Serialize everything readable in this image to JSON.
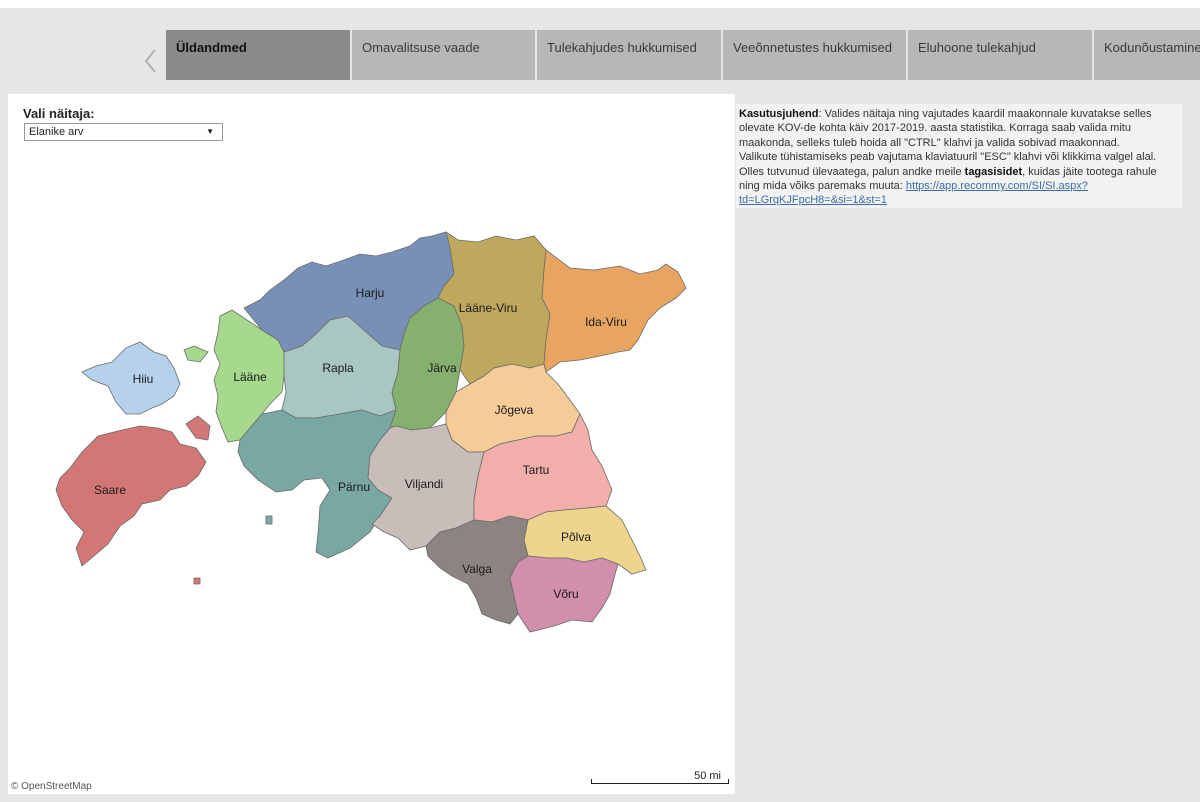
{
  "tabs": [
    {
      "label": "Üldandmed",
      "active": true
    },
    {
      "label": "Omavalitsuse vaade",
      "active": false
    },
    {
      "label": "Tulekahjudes hukkumised",
      "active": false
    },
    {
      "label": "Veeõnnetustes hukkumised",
      "active": false
    },
    {
      "label": "Eluhoone tulekahjud",
      "active": false
    },
    {
      "label": "Kodunõustamine",
      "active": false
    }
  ],
  "tab_prev_icon": "chevron-left-icon",
  "control": {
    "label": "Vali näitaja:",
    "selected": "Elanike arv",
    "icon": "caret-down-icon"
  },
  "map": {
    "counties": [
      {
        "name": "Harju",
        "color": "#7890b6"
      },
      {
        "name": "Lääne-Viru",
        "color": "#bea85e"
      },
      {
        "name": "Ida-Viru",
        "color": "#e8a562"
      },
      {
        "name": "Lääne",
        "color": "#a6d88d"
      },
      {
        "name": "Rapla",
        "color": "#a8c7c3"
      },
      {
        "name": "Järva",
        "color": "#86b06e"
      },
      {
        "name": "Hiiu",
        "color": "#b6d1ec"
      },
      {
        "name": "Jõgeva",
        "color": "#f5cb97"
      },
      {
        "name": "Saare",
        "color": "#d37676"
      },
      {
        "name": "Pärnu",
        "color": "#79a8a4"
      },
      {
        "name": "Viljandi",
        "color": "#c8bdb8"
      },
      {
        "name": "Tartu",
        "color": "#f1aeab"
      },
      {
        "name": "Põlva",
        "color": "#eed58d"
      },
      {
        "name": "Valga",
        "color": "#8c8481"
      },
      {
        "name": "Võru",
        "color": "#d18fab"
      }
    ],
    "attribution": "© OpenStreetMap",
    "scale_label": "50 mi"
  },
  "info": {
    "intro_bold": "Kasutusjuhend",
    "intro_text": ": Valides näitaja ning vajutades kaardil maakonnale kuvatakse selles olevate KOV-de kohta käiv 2017-2019. aasta statistika. Korraga saab valida mitu maakonda, selleks tuleb hoida all \"CTRL\" klahvi ja valida sobivad maakonnad.",
    "line2": "Valikute tühistamiseks peab vajutama klaviatuuril \"ESC\" klahvi või klikkima valgel alal.",
    "line3_pre": "Olles tutvunud ülevaatega, palun andke meile ",
    "line3_bold": "tagasisidet",
    "line3_post": ", kuidas jäite tootega rahule ning mida võiks paremaks muuta: ",
    "link": "https://app.recommy.com/SI/SI.aspx?td=LGrqKJFpcH8=&si=1&st=1"
  }
}
